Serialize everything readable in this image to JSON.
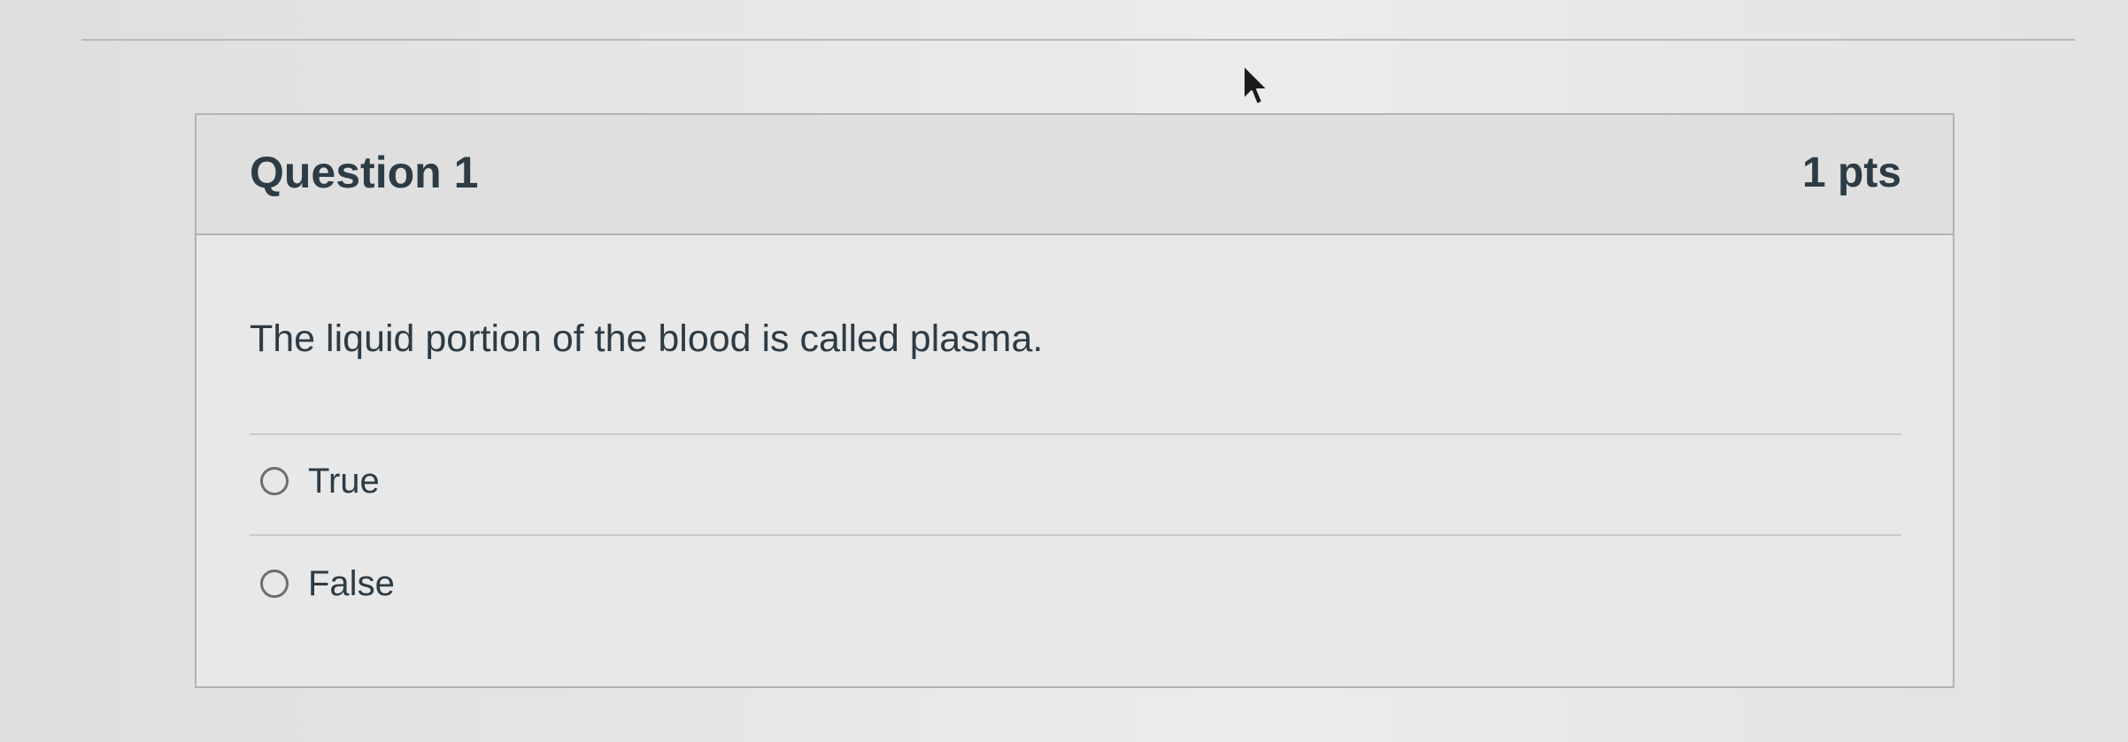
{
  "question": {
    "title": "Question 1",
    "points": "1 pts",
    "text": "The liquid portion of the blood is called plasma.",
    "answers": [
      {
        "label": "True",
        "selected": false
      },
      {
        "label": "False",
        "selected": false
      }
    ]
  },
  "icons": {
    "cursor": "mouse-pointer-icon",
    "radio": "radio-unchecked-icon"
  }
}
